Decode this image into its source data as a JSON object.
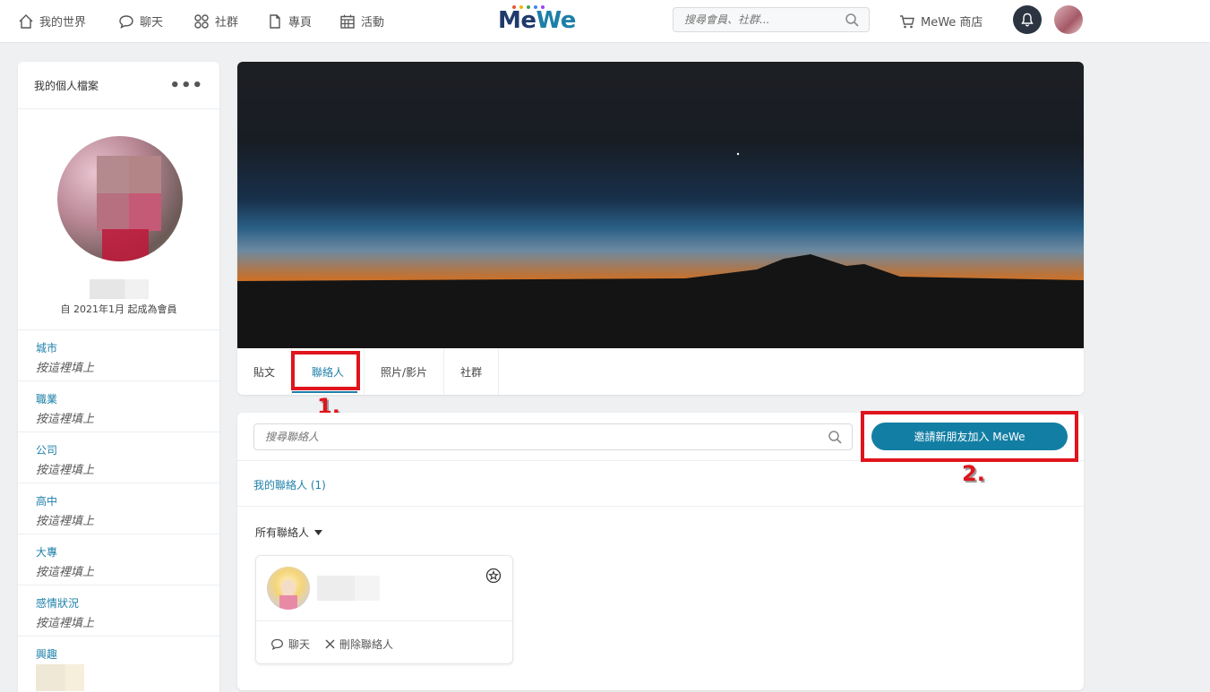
{
  "nav": {
    "items": [
      {
        "label": "我的世界",
        "icon": "home-icon"
      },
      {
        "label": "聊天",
        "icon": "chat-bubble-icon"
      },
      {
        "label": "社群",
        "icon": "groups-icon"
      },
      {
        "label": "專頁",
        "icon": "page-icon"
      },
      {
        "label": "活動",
        "icon": "calendar-icon"
      }
    ],
    "logo_me": "Me",
    "logo_we": "We",
    "search_placeholder": "搜尋會員、社群...",
    "shop_label": "MeWe 商店"
  },
  "profile": {
    "header_title": "我的個人檔案",
    "more_label": "•••",
    "member_since": "自 2021年1月 起成為會員",
    "fields": [
      {
        "label": "城市",
        "value": "按這裡填上"
      },
      {
        "label": "職業",
        "value": "按這裡填上"
      },
      {
        "label": "公司",
        "value": "按這裡填上"
      },
      {
        "label": "高中",
        "value": "按這裡填上"
      },
      {
        "label": "大專",
        "value": "按這裡填上"
      },
      {
        "label": "感情狀況",
        "value": "按這裡填上"
      },
      {
        "label": "興趣",
        "value": ""
      }
    ]
  },
  "tabs": [
    {
      "label": "貼文"
    },
    {
      "label": "聯絡人"
    },
    {
      "label": "照片/影片"
    },
    {
      "label": "社群"
    }
  ],
  "annotations": {
    "marker1": "1.",
    "marker2": "2."
  },
  "contacts": {
    "search_placeholder": "搜尋聯絡人",
    "invite_label": "邀請新朋友加入 MeWe",
    "my_contacts_label": "我的聯絡人 (1)",
    "filter_label": "所有聯絡人",
    "chat_label": "聊天",
    "remove_label": "刪除聯絡人"
  },
  "colors": {
    "accent": "#1d7fa8",
    "button": "#137ea4",
    "highlight": "#e0141c"
  }
}
